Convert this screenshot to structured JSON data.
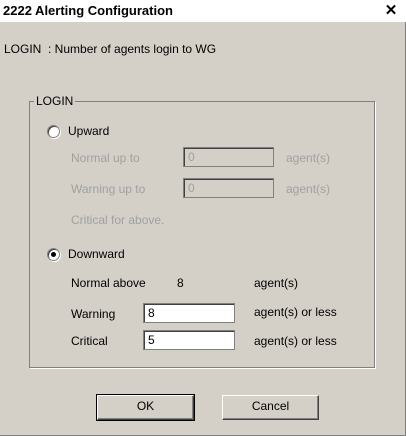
{
  "window": {
    "title": "2222 Alerting Configuration",
    "close_glyph": "✕"
  },
  "description": "LOGIN  : Number of agents login to WG",
  "group": {
    "title": "LOGIN",
    "upward": {
      "label": "Upward",
      "selected": false,
      "normal_label": "Normal up to",
      "normal_value": "0",
      "normal_unit": "agent(s)",
      "warning_label": "Warning up to",
      "warning_value": "0",
      "warning_unit": "agent(s)",
      "critical_label": "Critical for above."
    },
    "downward": {
      "label": "Downward",
      "selected": true,
      "normal_label": "Normal above",
      "normal_value": "8",
      "normal_unit": "agent(s)",
      "warning_label": "Warning",
      "warning_value": "8",
      "warning_unit": "agent(s) or less",
      "critical_label": "Critical",
      "critical_value": "5",
      "critical_unit": "agent(s) or less"
    }
  },
  "buttons": {
    "ok": "OK",
    "cancel": "Cancel"
  }
}
